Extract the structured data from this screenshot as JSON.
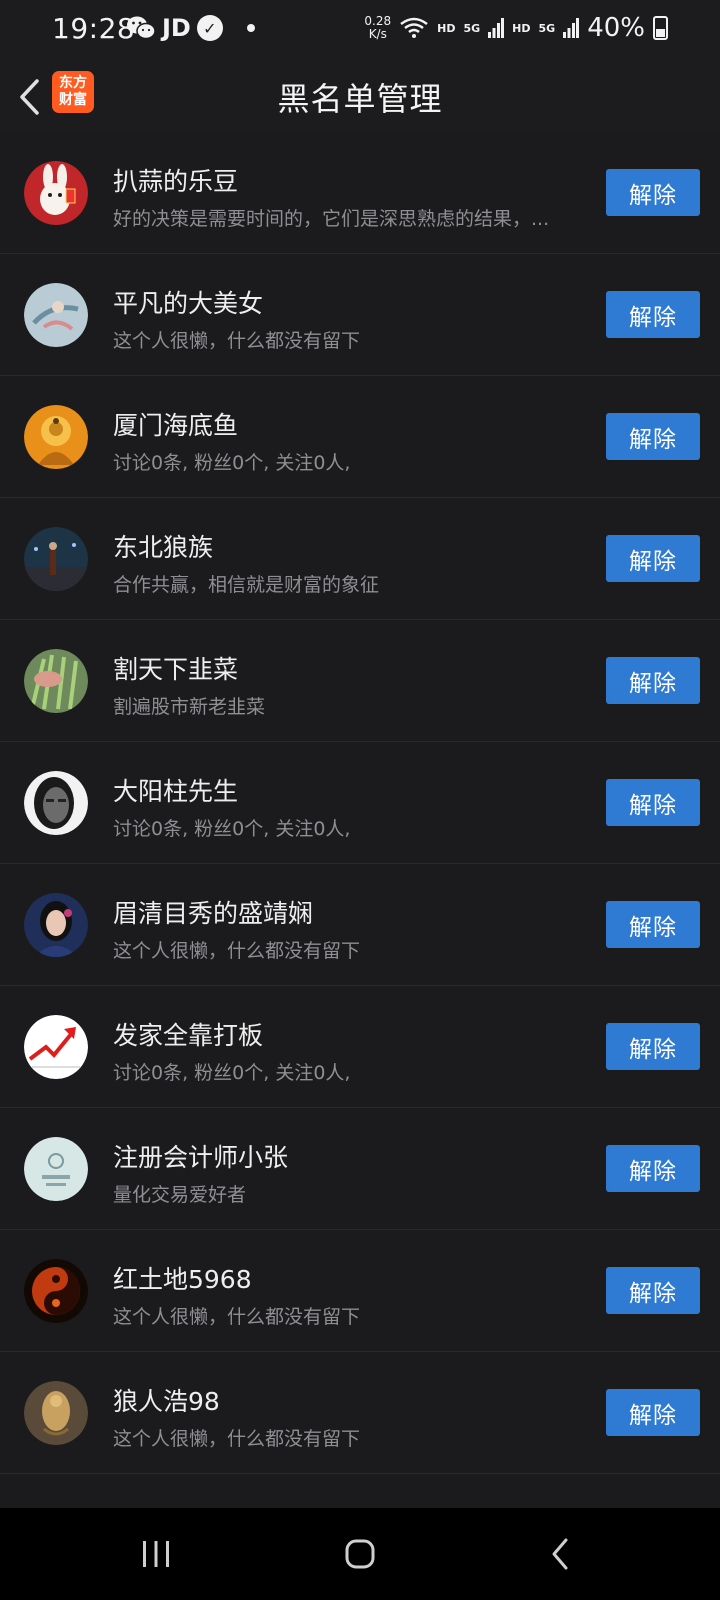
{
  "status_bar": {
    "time": "19:28",
    "carrier_badge": "JD",
    "net_speed_value": "0.28",
    "net_speed_unit": "K/s",
    "hd_label_1": "HD",
    "sig_label_1": "5G",
    "hd_label_2": "HD",
    "sig_label_2": "5G",
    "battery": "40%"
  },
  "header": {
    "title": "黑名单管理",
    "logo_line1": "东方",
    "logo_line2": "财富"
  },
  "blacklist": [
    {
      "name": "扒蒜的乐豆",
      "bio": "好的决策是需要时间的，它们是深思熟虑的结果，...",
      "button": "解除",
      "avatar": "rabbit-avatar"
    },
    {
      "name": "平凡的大美女",
      "bio": "这个人很懒，什么都没有留下",
      "button": "解除",
      "avatar": "painting-avatar"
    },
    {
      "name": "厦门海底鱼",
      "bio": "讨论0条, 粉丝0个, 关注0人,",
      "button": "解除",
      "avatar": "buddha-avatar"
    },
    {
      "name": "东北狼族",
      "bio": "合作共赢，相信就是财富的象征",
      "button": "解除",
      "avatar": "night-street-avatar"
    },
    {
      "name": "割天下韭菜",
      "bio": "割遍股市新老韭菜",
      "button": "解除",
      "avatar": "chives-avatar"
    },
    {
      "name": "大阳柱先生",
      "bio": "讨论0条, 粉丝0个, 关注0人,",
      "button": "解除",
      "avatar": "old-man-portrait-avatar"
    },
    {
      "name": "眉清目秀的盛靖娴",
      "bio": "这个人很懒，什么都没有留下",
      "button": "解除",
      "avatar": "woman-portrait-avatar"
    },
    {
      "name": "发家全靠打板",
      "bio": "讨论0条, 粉丝0个, 关注0人,",
      "button": "解除",
      "avatar": "red-up-arrow-avatar"
    },
    {
      "name": "注册会计师小张",
      "bio": "量化交易爱好者",
      "button": "解除",
      "avatar": "seal-avatar"
    },
    {
      "name": "红土地5968",
      "bio": "这个人很懒，什么都没有留下",
      "button": "解除",
      "avatar": "yin-yang-avatar"
    },
    {
      "name": "狼人浩98",
      "bio": "这个人很懒，什么都没有留下",
      "button": "解除",
      "avatar": "carving-avatar"
    }
  ],
  "nav_bar": {
    "items": [
      "recent-apps-icon",
      "home-icon",
      "back-icon"
    ]
  },
  "colors": {
    "background": "#1b1b1d",
    "button": "#2f7ad3",
    "logo": "#ff5a1f",
    "secondary_text": "#8e8e93"
  }
}
